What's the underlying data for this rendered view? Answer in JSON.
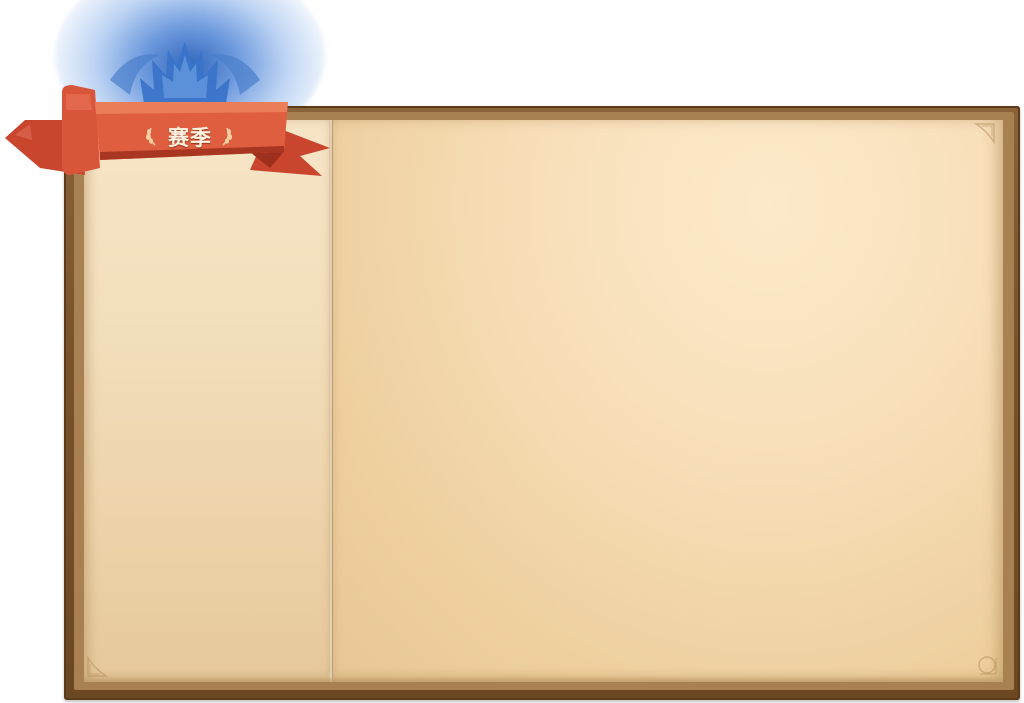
{
  "banner": {
    "title": "赛季",
    "left_laurel_icon": "laurel-left-icon",
    "right_laurel_icon": "laurel-right-icon"
  },
  "emblem": {
    "icon": "crown-crest-icon",
    "glow_color": "#2f63b8"
  },
  "colors": {
    "ribbon": "#d9553a",
    "ribbon_dark": "#b23a24",
    "page": "#f5e3c3",
    "frame": "#7a5329"
  }
}
